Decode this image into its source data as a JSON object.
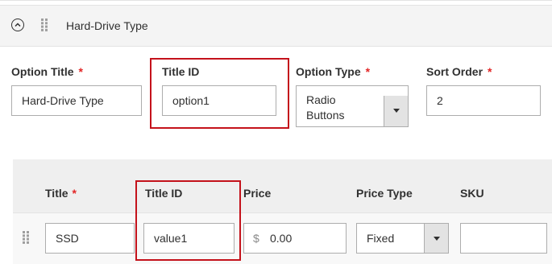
{
  "header": {
    "title": "Hard-Drive Type"
  },
  "option": {
    "title_label": "Option Title",
    "title_value": "Hard-Drive Type",
    "title_id_label": "Title ID",
    "title_id_value": "option1",
    "type_label": "Option Type",
    "type_value_line1": "Radio",
    "type_value_line2": "Buttons",
    "sort_label": "Sort Order",
    "sort_value": "2",
    "required_mark": "*"
  },
  "grid": {
    "headers": {
      "title": "Title",
      "title_id": "Title ID",
      "price": "Price",
      "price_type": "Price Type",
      "sku": "SKU"
    },
    "required_mark": "*",
    "row": {
      "title": "SSD",
      "title_id": "value1",
      "currency": "$",
      "price": "0.00",
      "price_type": "Fixed",
      "sku": ""
    }
  },
  "colors": {
    "highlight": "#c4121b",
    "required": "#e22626",
    "header_bg": "#f4f4f4",
    "grid_bg": "#efefef"
  },
  "icons": [
    "collapse-circle-icon",
    "drag-handle-icon",
    "dropdown-arrow-icon"
  ]
}
